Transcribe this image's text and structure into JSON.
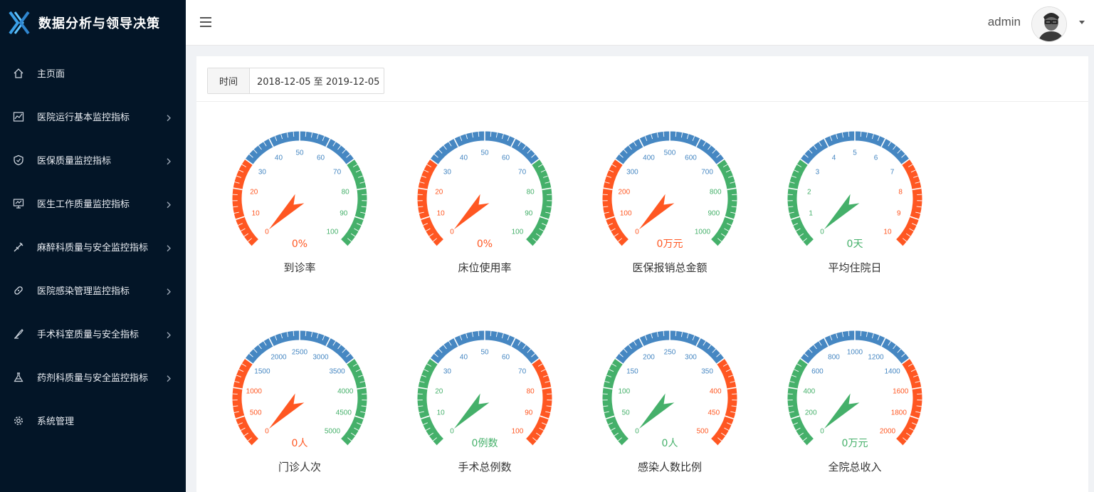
{
  "app": {
    "title": "数据分析与领导决策"
  },
  "sidebar": {
    "items": [
      {
        "label": "主页面",
        "icon": "home-icon",
        "has_arrow": false
      },
      {
        "label": "医院运行基本监控指标",
        "icon": "chart-icon",
        "has_arrow": true
      },
      {
        "label": "医保质量监控指标",
        "icon": "shield-icon",
        "has_arrow": true
      },
      {
        "label": "医生工作质量监控指标",
        "icon": "monitor-icon",
        "has_arrow": true
      },
      {
        "label": "麻醉科质量与安全监控指标",
        "icon": "syringe-icon",
        "has_arrow": true
      },
      {
        "label": "医院感染管理监控指标",
        "icon": "bandage-icon",
        "has_arrow": true
      },
      {
        "label": "手术科室质量与安全指标",
        "icon": "scalpel-icon",
        "has_arrow": true
      },
      {
        "label": "药剂科质量与安全监控指标",
        "icon": "flask-icon",
        "has_arrow": true
      },
      {
        "label": "系统管理",
        "icon": "gear-icon",
        "has_arrow": false
      }
    ]
  },
  "header": {
    "user": "admin"
  },
  "filter": {
    "label": "时间",
    "value": "2018-12-05 至 2019-12-05"
  },
  "colors": {
    "red": "#ff5722",
    "green": "#45b06a",
    "blue": "#4687c2",
    "sidebar": "#031527"
  },
  "gauges": [
    {
      "title": "到诊率",
      "value": 0,
      "display": "0%",
      "min": 0,
      "max": 100,
      "bands": [
        "red",
        "blue",
        "green"
      ],
      "labels": [
        "0",
        "10",
        "20",
        "30",
        "40",
        "50",
        "60",
        "70",
        "80",
        "90",
        "100"
      ]
    },
    {
      "title": "床位使用率",
      "value": 0,
      "display": "0%",
      "min": 0,
      "max": 100,
      "bands": [
        "red",
        "blue",
        "green"
      ],
      "labels": [
        "0",
        "10",
        "20",
        "30",
        "40",
        "50",
        "60",
        "70",
        "80",
        "90",
        "100"
      ]
    },
    {
      "title": "医保报销总金额",
      "value": 0,
      "display": "0万元",
      "min": 0,
      "max": 1000,
      "bands": [
        "red",
        "blue",
        "green"
      ],
      "labels": [
        "0",
        "100",
        "200",
        "300",
        "400",
        "500",
        "600",
        "700",
        "800",
        "900",
        "1000"
      ]
    },
    {
      "title": "平均住院日",
      "value": 0,
      "display": "0天",
      "min": 0,
      "max": 10,
      "bands": [
        "green",
        "blue",
        "red"
      ],
      "labels": [
        "0",
        "1",
        "2",
        "3",
        "4",
        "5",
        "6",
        "7",
        "8",
        "9",
        "10"
      ]
    },
    {
      "title": "门诊人次",
      "value": 0,
      "display": "0人",
      "min": 0,
      "max": 5000,
      "bands": [
        "red",
        "blue",
        "green"
      ],
      "labels": [
        "0",
        "500",
        "1000",
        "1500",
        "2000",
        "2500",
        "3000",
        "3500",
        "4000",
        "4500",
        "5000"
      ]
    },
    {
      "title": "手术总例数",
      "value": 0,
      "display": "0例数",
      "min": 0,
      "max": 100,
      "bands": [
        "green",
        "blue",
        "red"
      ],
      "labels": [
        "0",
        "10",
        "20",
        "30",
        "40",
        "50",
        "60",
        "70",
        "80",
        "90",
        "100"
      ]
    },
    {
      "title": "感染人数比例",
      "value": 0,
      "display": "0人",
      "min": 0,
      "max": 500,
      "bands": [
        "green",
        "blue",
        "red"
      ],
      "labels": [
        "0",
        "50",
        "100",
        "150",
        "200",
        "250",
        "300",
        "350",
        "400",
        "450",
        "500"
      ]
    },
    {
      "title": "全院总收入",
      "value": 0,
      "display": "0万元",
      "min": 0,
      "max": 2000,
      "bands": [
        "green",
        "blue",
        "red"
      ],
      "labels": [
        "0",
        "200",
        "400",
        "600",
        "800",
        "1000",
        "1200",
        "1400",
        "1600",
        "1800",
        "2000"
      ]
    }
  ]
}
